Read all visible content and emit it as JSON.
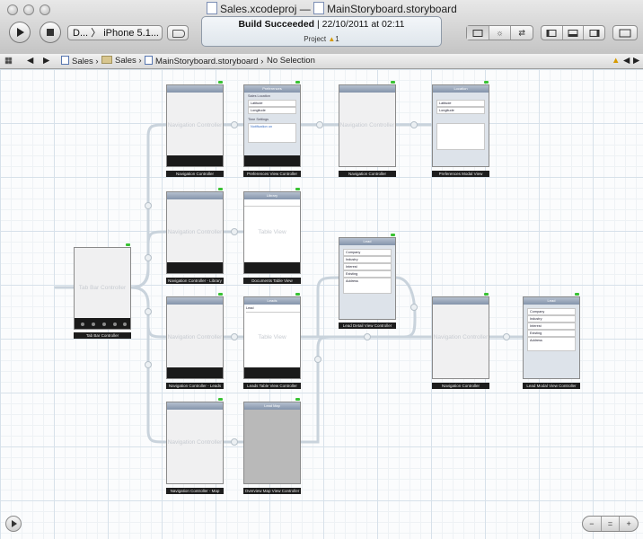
{
  "window": {
    "project_file": "Sales.xcodeproj",
    "separator": "—",
    "document": "MainStoryboard.storyboard"
  },
  "toolbar": {
    "scheme": "D... 〉 iPhone 5.1...",
    "activity_status": "Build Succeeded",
    "activity_divider": "|",
    "activity_time": "22/10/2011 at 02:11",
    "activity_project": "Project",
    "activity_warning_count": "1",
    "editor_segment_icons": [
      "standard-editor-icon",
      "assistant-editor-icon",
      "version-editor-icon"
    ],
    "view_segment_icons": [
      "navigator-panel-icon",
      "debug-panel-icon",
      "utilities-panel-icon"
    ],
    "organizer_label": "Organizer"
  },
  "jumpbar": {
    "crumbs": [
      "Sales",
      "Sales",
      "MainStoryboard.storyboard",
      "No Selection"
    ]
  },
  "scenes": {
    "tabbar": {
      "title": "Tab Bar Controller",
      "label": "Tab Bar Controller"
    },
    "nav1": {
      "title": "Navigation Controller",
      "label": "Navigation Controller"
    },
    "pref": {
      "title": "Preferences",
      "label": "Preferences View Controller",
      "section1": "Sales Location",
      "row1": "Latitude",
      "row2": "Longitude",
      "section2": "Time Settings",
      "row3": "Notification on"
    },
    "nav2": {
      "title": "Navigation Controller",
      "label": "Navigation Controller"
    },
    "prefmodal": {
      "title": "Location",
      "label": "Preferences Modal View",
      "row1": "Latitude",
      "row2": "Longitude"
    },
    "nav3": {
      "title": "Navigation Controller",
      "label": "Navigation Controller - Library"
    },
    "docs": {
      "title": "Library",
      "label": "Documents Table View",
      "ghost": "Table View"
    },
    "leaddetail": {
      "title": "Lead",
      "label": "Lead Detail View Controller",
      "rows": [
        "Company",
        "Industry",
        "Interest",
        "Existing",
        "Address"
      ]
    },
    "nav4": {
      "title": "Navigation Controller",
      "label": "Navigation Controller - Leads"
    },
    "leadstable": {
      "title": "Leads",
      "label": "Leads Table View Controller",
      "ghost": "Table View",
      "row": "Lead"
    },
    "nav5": {
      "title": "Navigation Controller",
      "label": "Navigation Controller"
    },
    "leadmodal": {
      "title": "Lead",
      "label": "Lead Modal View Controller",
      "rows": [
        "Company",
        "Industry",
        "Interest",
        "Existing",
        "Address"
      ]
    },
    "nav6": {
      "title": "Navigation Controller",
      "label": "Navigation Controller - Map"
    },
    "map": {
      "title": "Lead Map",
      "label": "Overview Map View Controller"
    }
  },
  "colors": {
    "accent": "#3a6fc4",
    "dock_green": "#39c233",
    "warning": "#d69a00"
  }
}
